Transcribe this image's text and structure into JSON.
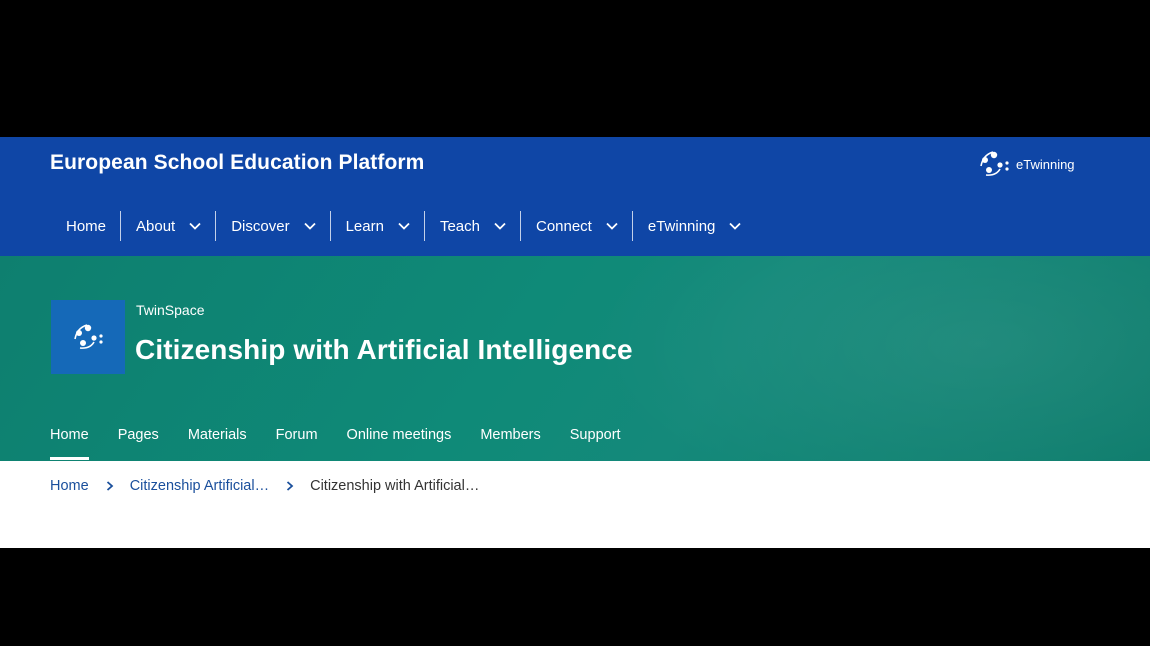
{
  "header": {
    "site_title": "European School Education Platform",
    "brand_label": "eTwinning"
  },
  "main_nav": [
    {
      "label": "Home",
      "dropdown": false
    },
    {
      "label": "About",
      "dropdown": true
    },
    {
      "label": "Discover",
      "dropdown": true
    },
    {
      "label": "Learn",
      "dropdown": true
    },
    {
      "label": "Teach",
      "dropdown": true
    },
    {
      "label": "Connect",
      "dropdown": true
    },
    {
      "label": "eTwinning",
      "dropdown": true
    }
  ],
  "space": {
    "kicker": "TwinSpace",
    "title": "Citizenship with Artificial Intelligence"
  },
  "sub_nav": {
    "active": "Home",
    "items": [
      "Home",
      "Pages",
      "Materials",
      "Forum",
      "Online meetings",
      "Members",
      "Support"
    ]
  },
  "breadcrumb": {
    "items": [
      "Home",
      "Citizenship Artificial…"
    ],
    "current": "Citizenship with Artificial…"
  },
  "colors": {
    "header_blue": "#0f46a6",
    "banner_teal": "#0f8a78",
    "logo_blue": "#1569b8",
    "link_blue": "#1a4f9c"
  },
  "icons": [
    "etwinning-logo-icon",
    "chevron-down-icon",
    "chevron-right-icon"
  ]
}
